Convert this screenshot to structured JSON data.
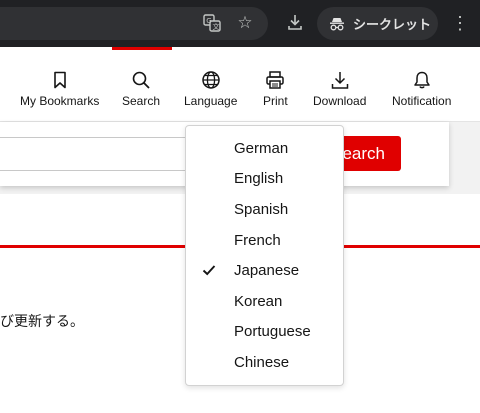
{
  "browser": {
    "incognito_label": "シークレット",
    "icons": [
      "translate-icon",
      "star-icon",
      "download-icon",
      "incognito-icon",
      "more-vert-icon"
    ]
  },
  "header": {
    "nav": [
      {
        "label": "My Bookmarks",
        "icon": "bookmark-icon"
      },
      {
        "label": "Search",
        "icon": "search-icon",
        "active": true
      },
      {
        "label": "Language",
        "icon": "globe-icon"
      },
      {
        "label": "Print",
        "icon": "printer-icon"
      },
      {
        "label": "Download",
        "icon": "download-icon"
      },
      {
        "label": "Notification",
        "icon": "bell-icon"
      }
    ],
    "accent_color": "#e00000"
  },
  "search": {
    "button_label": "Search",
    "input_value": ""
  },
  "content": {
    "jp_text": "び更新する。"
  },
  "language_menu": {
    "selected": "Japanese",
    "options": [
      "German",
      "English",
      "Spanish",
      "French",
      "Japanese",
      "Korean",
      "Portuguese",
      "Chinese"
    ]
  }
}
